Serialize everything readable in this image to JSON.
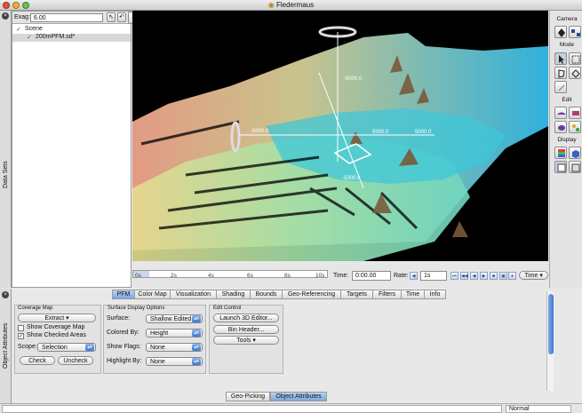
{
  "window": {
    "title": "Fledermaus"
  },
  "left_panel": {
    "tab_label": "Data Sets",
    "exag_label": "Exag:",
    "exag_value": "6.00",
    "tree": {
      "root": "Scene",
      "child": "200mPFM.sd*"
    }
  },
  "right_panel": {
    "camera": "Camera",
    "mode": "Mode",
    "edit": "Edit",
    "display": "Display"
  },
  "timeline": {
    "ticks": [
      "0s",
      "2s",
      "4s",
      "6s",
      "8s",
      "10s"
    ],
    "time_label": "Time:",
    "time_value": "0:00.00",
    "rate_label": "Rate:",
    "rate_value": "1s",
    "time_menu": "Time"
  },
  "tabs": [
    "PFM",
    "Color Map",
    "Visualization",
    "Shading",
    "Bounds",
    "Geo-Referencing",
    "Targets",
    "Filters",
    "Time",
    "Info"
  ],
  "object_panel": {
    "side_label": "Object Attributes",
    "coverage": {
      "title": "Coverage Map",
      "extract": "Extract",
      "show_coverage": "Show Coverage Map",
      "show_checked": "Show Checked Areas",
      "scope_label": "Scope:",
      "scope_value": "Selection",
      "check": "Check",
      "uncheck": "Uncheck"
    },
    "surface": {
      "title": "Surface Display Options",
      "surface_label": "Surface:",
      "surface_value": "Shallow Edited",
      "colored_label": "Colored By:",
      "colored_value": "Height",
      "flags_label": "Show Flags:",
      "flags_value": "None",
      "highlight_label": "Highlight By:",
      "highlight_value": "None"
    },
    "edit": {
      "title": "Edit Control",
      "launch": "Launch 3D Editor...",
      "bin": "Bin Header...",
      "tools": "Tools"
    }
  },
  "bottom_tabs": {
    "geo": "Geo-Picking",
    "obj": "Object Attributes"
  },
  "status": {
    "mode": "Normal"
  },
  "scene_labels": [
    "-5000.0",
    "-5000.0",
    "5000.0",
    "5000.0",
    "-5000.0"
  ],
  "colors": {
    "accent": "#3d79cf",
    "tab_selected": "#8fb6ea"
  }
}
